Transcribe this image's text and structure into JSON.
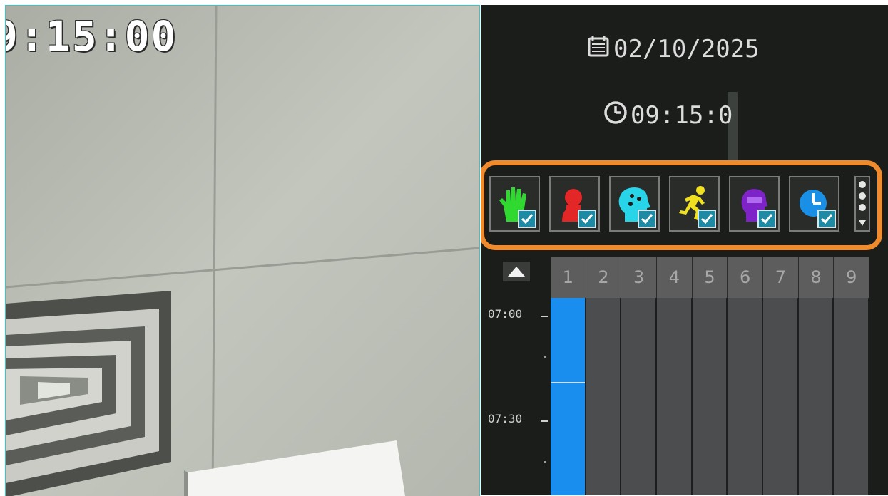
{
  "camera": {
    "osd_time": "9:15:00"
  },
  "panel": {
    "date": "02/10/2025",
    "time": "09:15:0"
  },
  "filters": [
    {
      "name": "hand",
      "color": "#2fd92f",
      "checked": true
    },
    {
      "name": "person",
      "color": "#e32626",
      "checked": true
    },
    {
      "name": "face",
      "color": "#27d4e8",
      "checked": true
    },
    {
      "name": "running",
      "color": "#f0e020",
      "checked": true
    },
    {
      "name": "head",
      "color": "#7d23c7",
      "checked": true
    },
    {
      "name": "clock",
      "color": "#1a8fe6",
      "checked": true
    }
  ],
  "timeline": {
    "channels": [
      "1",
      "2",
      "3",
      "4",
      "5",
      "6",
      "7",
      "8",
      "9"
    ],
    "time_labels": [
      "07:00",
      "07:30"
    ],
    "accent": "#1a8eee",
    "highlight_color": "#ef8a2d"
  }
}
